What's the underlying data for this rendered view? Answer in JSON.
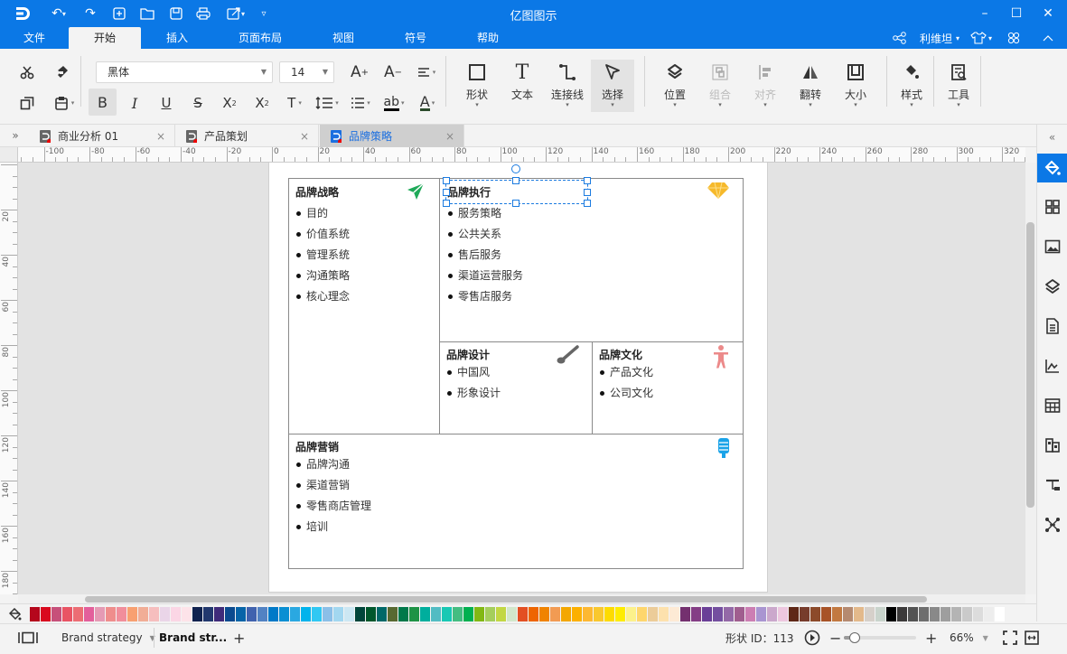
{
  "app": {
    "title": "亿图图示",
    "accent_color": "#0b78e6"
  },
  "quick_access": [
    {
      "icon": "app-logo-icon"
    },
    {
      "icon": "undo-icon"
    },
    {
      "icon": "redo-icon"
    },
    {
      "icon": "new-icon"
    },
    {
      "icon": "open-folder-icon"
    },
    {
      "icon": "save-icon"
    },
    {
      "icon": "print-icon"
    },
    {
      "icon": "export-icon"
    },
    {
      "icon": "customize-icon"
    }
  ],
  "window_controls": {
    "minimize": "–",
    "maximize": "☐",
    "close": "✕"
  },
  "menu": {
    "items": [
      "文件",
      "开始",
      "插入",
      "页面布局",
      "视图",
      "符号",
      "帮助"
    ],
    "active": "开始",
    "user": "利维坦",
    "right_icons": [
      "share-icon",
      "skin-icon",
      "apps-icon",
      "collapse-ribbon-icon"
    ]
  },
  "ribbon": {
    "font_family": "黑体",
    "font_size": "14",
    "small_buttons": [
      "cut",
      "format-painter",
      "copy",
      "paste",
      "increase-font",
      "decrease-font",
      "align",
      "bold",
      "italic",
      "underline",
      "strikethrough",
      "superscript",
      "subscript",
      "text-style",
      "line-spacing",
      "bullets",
      "highlight",
      "font-color"
    ],
    "big_buttons": [
      {
        "label": "形状",
        "icon": "shape-icon",
        "dropdown": true,
        "disabled": false
      },
      {
        "label": "文本",
        "icon": "text-icon",
        "dropdown": false,
        "disabled": false
      },
      {
        "label": "连接线",
        "icon": "connector-icon",
        "dropdown": true,
        "disabled": false
      },
      {
        "label": "选择",
        "icon": "select-icon",
        "dropdown": true,
        "disabled": false,
        "selected": true
      },
      {
        "label": "位置",
        "icon": "position-icon",
        "dropdown": true,
        "disabled": false
      },
      {
        "label": "组合",
        "icon": "group-icon",
        "dropdown": true,
        "disabled": true
      },
      {
        "label": "对齐",
        "icon": "align-icon",
        "dropdown": true,
        "disabled": true
      },
      {
        "label": "翻转",
        "icon": "flip-icon",
        "dropdown": true,
        "disabled": false
      },
      {
        "label": "大小",
        "icon": "size-icon",
        "dropdown": true,
        "disabled": false
      },
      {
        "label": "样式",
        "icon": "style-icon",
        "dropdown": true,
        "disabled": false
      },
      {
        "label": "工具",
        "icon": "tools-icon",
        "dropdown": true,
        "disabled": false
      }
    ]
  },
  "doc_tabs": [
    {
      "label": "商业分析 01",
      "active": false,
      "close": "×"
    },
    {
      "label": "产品策划",
      "active": false,
      "close": "×"
    },
    {
      "label": "品牌策略",
      "active": true,
      "close": "×"
    }
  ],
  "rulers": {
    "horizontal_ticks": [
      "-100",
      "-80",
      "-60",
      "-40",
      "-20",
      "0",
      "20",
      "40",
      "60",
      "80",
      "100",
      "120",
      "140",
      "160",
      "180",
      "200",
      "220",
      "240",
      "260",
      "280",
      "300",
      "320"
    ],
    "vertical_ticks": [
      "20",
      "40",
      "60",
      "80",
      "100",
      "120",
      "140",
      "160",
      "180"
    ]
  },
  "diagram": {
    "cells": [
      {
        "title": "品牌战略",
        "icon": "paper-plane-icon",
        "icon_color": "#1faa59",
        "items": [
          "目的",
          "价值系统",
          "管理系统",
          "沟通策略",
          "核心理念"
        ]
      },
      {
        "title": "品牌执行",
        "icon": "diamond-icon",
        "icon_color": "#f6b92b",
        "items": [
          "服务策略",
          "公共关系",
          "售后服务",
          "渠道运营服务",
          "零售店服务"
        ]
      },
      {
        "title": "品牌设计",
        "icon": "brush-icon",
        "icon_color": "#666666",
        "items": [
          "中国风",
          "形象设计"
        ]
      },
      {
        "title": "品牌文化",
        "icon": "person-icon",
        "icon_color": "#ec8a8a",
        "items": [
          "产品文化",
          "公司文化"
        ]
      },
      {
        "title": "品牌营销",
        "icon": "microphone-icon",
        "icon_color": "#1aa3e8",
        "items": [
          "品牌沟通",
          "渠道营销",
          "零售商店管理",
          "培训"
        ]
      }
    ],
    "selected_shape": "品牌执行"
  },
  "right_panel": [
    "collapse-icon",
    "fill-icon",
    "shapes-library-icon",
    "image-icon",
    "layers-icon",
    "page-icon",
    "chart-icon",
    "table-icon",
    "org-icon",
    "gantt-icon",
    "mindmap-icon"
  ],
  "palette": [
    "#b5071c",
    "#d9091f",
    "#c7507a",
    "#e95464",
    "#ec6d74",
    "#e35f9b",
    "#e59ab4",
    "#ef8d8c",
    "#f18e9b",
    "#f8a071",
    "#f1ad96",
    "#f6bebe",
    "#ead5e8",
    "#fbd6e5",
    "#fde3e9",
    "#10224f",
    "#22386e",
    "#3f2b7a",
    "#0b4a8f",
    "#0764a8",
    "#4062ae",
    "#5282c3",
    "#0079c8",
    "#0a8fd3",
    "#2aa8e1",
    "#00b3ec",
    "#30c8f3",
    "#8bbfe8",
    "#a2d7f0",
    "#cce7f3",
    "#00453a",
    "#00572c",
    "#006868",
    "#586931",
    "#00784a",
    "#1e9346",
    "#00ae9d",
    "#52bcc3",
    "#19c8b4",
    "#44bd82",
    "#00b050",
    "#82b814",
    "#a5ce5c",
    "#c2d743",
    "#d2e7cb",
    "#e34f23",
    "#ee6500",
    "#f08300",
    "#f29b53",
    "#f3a702",
    "#fcb000",
    "#fdb832",
    "#f9c82e",
    "#fddb00",
    "#feec00",
    "#fcf18b",
    "#fed66d",
    "#eccc99",
    "#fde1ad",
    "#fdead5",
    "#74306f",
    "#843d85",
    "#6a3f97",
    "#744f9f",
    "#9469a7",
    "#a05e8f",
    "#cc7eb3",
    "#a995d1",
    "#cba8cc",
    "#edc7df",
    "#5e2717",
    "#773c2c",
    "#8c4a2a",
    "#a85327",
    "#c27941",
    "#b58a70",
    "#e3b98b",
    "#d6d0ca",
    "#c9d4cc",
    "#000000",
    "#3c3a3a",
    "#535353",
    "#6e6e6e",
    "#898989",
    "#9e9e9e",
    "#b4b4b4",
    "#cacaca",
    "#dcdcdc",
    "#ededed",
    "#ffffff"
  ],
  "status": {
    "page_menu": "Brand strategy",
    "current_page": "Brand str...",
    "add_page": "+",
    "shape_id": "形状 ID：113",
    "zoom": "66%",
    "zoom_level_fraction": 0.15
  }
}
